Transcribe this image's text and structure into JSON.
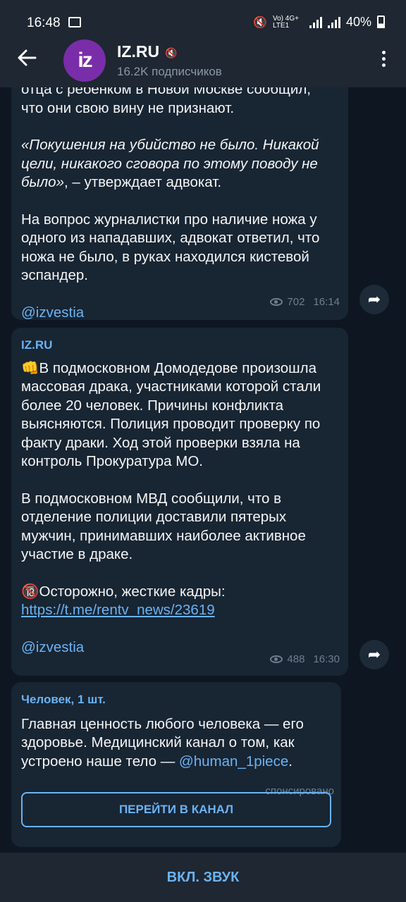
{
  "status_bar": {
    "time": "16:48",
    "network": "Vo) 4G+ LTE1",
    "battery": "40%"
  },
  "channel": {
    "avatar_text": "iz",
    "title": "IZ.RU",
    "subscribers": "16.2K подписчиков"
  },
  "messages": [
    {
      "lines": [
        "отца с ребенком в Новой Москве сообщил,",
        "что они свою вину не признают."
      ],
      "quote_italic": "«Покушения на убийство не было. Никакой цели, никакого сговора по этому поводу не было»",
      "quote_rest": ", – утверждает адвокат.",
      "para2": "На вопрос журналистки про наличие ножа у одного из нападавших, адвокат ответил, что ножа не было, в руках находился кистевой эспандер.",
      "signature": "@izvestia",
      "views": "702",
      "time": "16:14"
    },
    {
      "header": "IZ.RU",
      "emoji": "👊",
      "para1": "В подмосковном Домодедове произошла массовая драка, участниками которой стали более 20 человек. Причины конфликта выясняются. Полиция проводит проверку по факту драки. Ход этой проверки взяла на контроль Прокуратура МО.",
      "para2": "В подмосковном МВД сообщили, что в отделение полиции доставили пятерых мужчин, принимавших наиболее активное участие в драке.",
      "warning_emoji": "🔞",
      "warning": "Осторожно, жесткие кадры:",
      "url": "https://t.me/rentv_news/23619",
      "signature": "@izvestia",
      "views": "488",
      "time": "16:30"
    }
  ],
  "ad": {
    "title": "Человек, 1 шт.",
    "text": "Главная ценность любого человека — его здоровье. Медицинский канал о том, как устроено наше тело — ",
    "mention": "@human_1piece",
    "text_end": ".",
    "sponsored": "спонсировано",
    "button": "ПЕРЕЙТИ В КАНАЛ"
  },
  "bottom_button": "ВКЛ. ЗВУК",
  "colors": {
    "background": "#0e1621",
    "bubble": "#182533",
    "header": "#1e2732",
    "accent": "#6ab3f3",
    "avatar": "#7a2da8"
  }
}
